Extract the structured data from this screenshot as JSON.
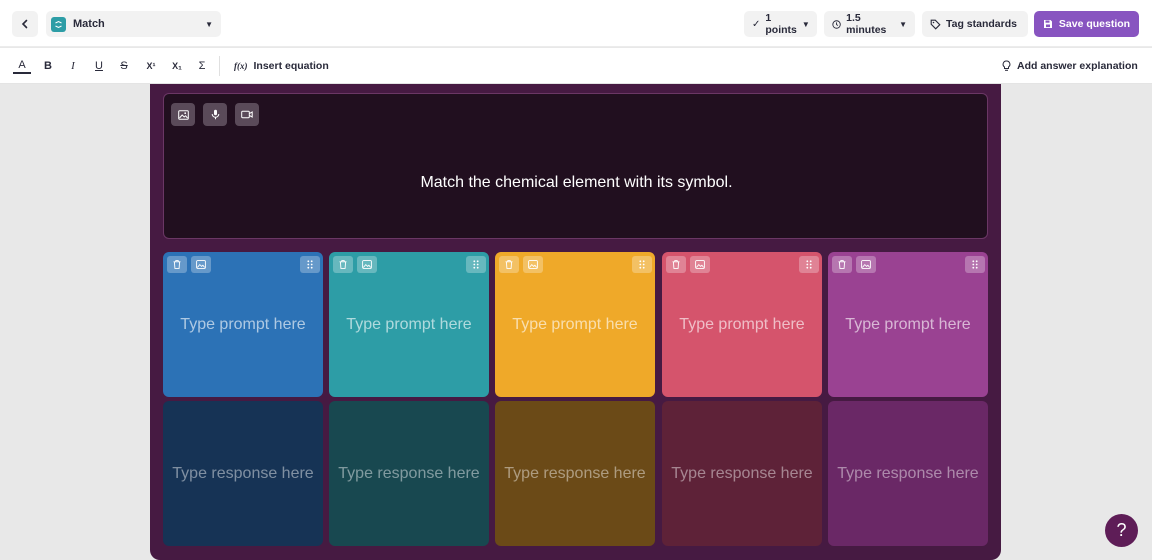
{
  "header": {
    "question_type": "Match",
    "points": "1 points",
    "time": "1.5 minutes",
    "tag_standards": "Tag standards",
    "save": "Save question"
  },
  "toolbar": {
    "text_color": "A",
    "bold": "B",
    "italic": "I",
    "underline": "U",
    "strikethrough": "S",
    "superscript": "X¹",
    "subscript": "X₁",
    "sigma": "Σ",
    "insert_equation_icon": "f(x)",
    "insert_equation": "Insert equation",
    "add_explanation": "Add answer explanation"
  },
  "question": {
    "text": "Match the chemical element with its symbol."
  },
  "pairs": [
    {
      "prompt": "Type prompt here",
      "response": "Type response here",
      "prompt_color": "#2c72b6",
      "response_color": "#163355"
    },
    {
      "prompt": "Type prompt here",
      "response": "Type response here",
      "prompt_color": "#2d9da6",
      "response_color": "#184850"
    },
    {
      "prompt": "Type prompt here",
      "response": "Type response here",
      "prompt_color": "#efa929",
      "response_color": "#6b4a17"
    },
    {
      "prompt": "Type prompt here",
      "response": "Type response here",
      "prompt_color": "#d5546c",
      "response_color": "#5e2238"
    },
    {
      "prompt": "Type prompt here",
      "response": "Type response here",
      "prompt_color": "#9a4292",
      "response_color": "#6a2866"
    }
  ],
  "help": "?",
  "colors": {
    "accent": "#8854c0",
    "editor_bg": "#461a42",
    "question_bg": "#210f1f"
  }
}
